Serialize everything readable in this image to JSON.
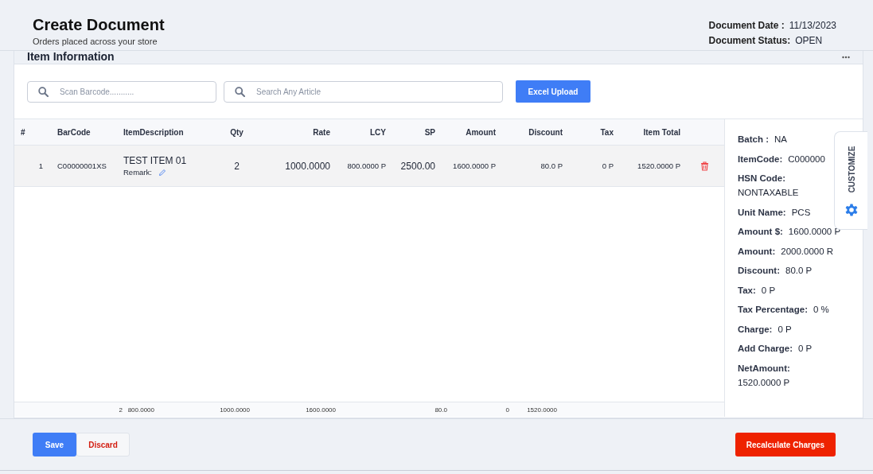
{
  "header": {
    "title": "Create Document",
    "subtitle": "Orders placed across your store",
    "meta": [
      {
        "label": "Document Date :",
        "value": "11/13/2023"
      },
      {
        "label": "Document Status:",
        "value": "OPEN"
      }
    ]
  },
  "section": {
    "title": "Item Information"
  },
  "search": [
    {
      "placeholder": "Scan Barcode..........."
    },
    {
      "placeholder": "Search Any Article"
    }
  ],
  "upload_button": "Excel Upload",
  "table": {
    "columns": [
      "#",
      "BarCode",
      "ItemDescription",
      "Qty",
      "Rate",
      "LCY",
      "SP",
      "Amount",
      "Discount",
      "Tax",
      "Item Total"
    ],
    "rows": [
      {
        "cells": [
          "1",
          "C00000001XS",
          "TEST ITEM 01",
          "2",
          "1000.0000",
          "800.0000 P",
          "2500.00",
          "1600.0000 P",
          "80.0 P",
          "0 P",
          "1520.0000 P"
        ],
        "remark": "Remark:"
      }
    ],
    "totals": [
      "2",
      "800.0000",
      "1000.0000",
      "1600.0000",
      "80.0",
      "0",
      "1520.0000"
    ]
  },
  "details": [
    {
      "label": "Batch :",
      "value": "NA",
      "kind": "inline"
    },
    {
      "label": "ItemCode:",
      "value": "C000000",
      "kind": "inline"
    },
    {
      "label": "HSN Code:",
      "value": "NONTAXABLE",
      "kind": "stacked"
    },
    {
      "label": "Unit Name:",
      "value": "PCS",
      "kind": "inline"
    },
    {
      "label": "Amount $:",
      "value": "1600.0000 P",
      "kind": "inline"
    },
    {
      "label": "Amount:",
      "value": "2000.0000 R",
      "kind": "inline"
    },
    {
      "label": "Discount:",
      "value": "80.0 P",
      "kind": "inline"
    },
    {
      "label": "Tax:",
      "value": "0 P",
      "kind": "inline"
    },
    {
      "label": "Tax Percentage:",
      "value": "0 %",
      "kind": "inline"
    },
    {
      "label": "Charge:",
      "value": "0 P",
      "kind": "inline"
    },
    {
      "label": "Add Charge:",
      "value": "0 P",
      "kind": "inline"
    },
    {
      "label": "NetAmount:",
      "value": "1520.0000 P",
      "kind": "stacked"
    }
  ],
  "customize": "CUSTOMIZE",
  "footer": {
    "buttons": [
      {
        "label": "Save",
        "kind": "primary"
      },
      {
        "label": "Discard",
        "kind": "secondary"
      },
      {
        "label": "Recalculate Charges",
        "kind": "danger"
      }
    ]
  }
}
